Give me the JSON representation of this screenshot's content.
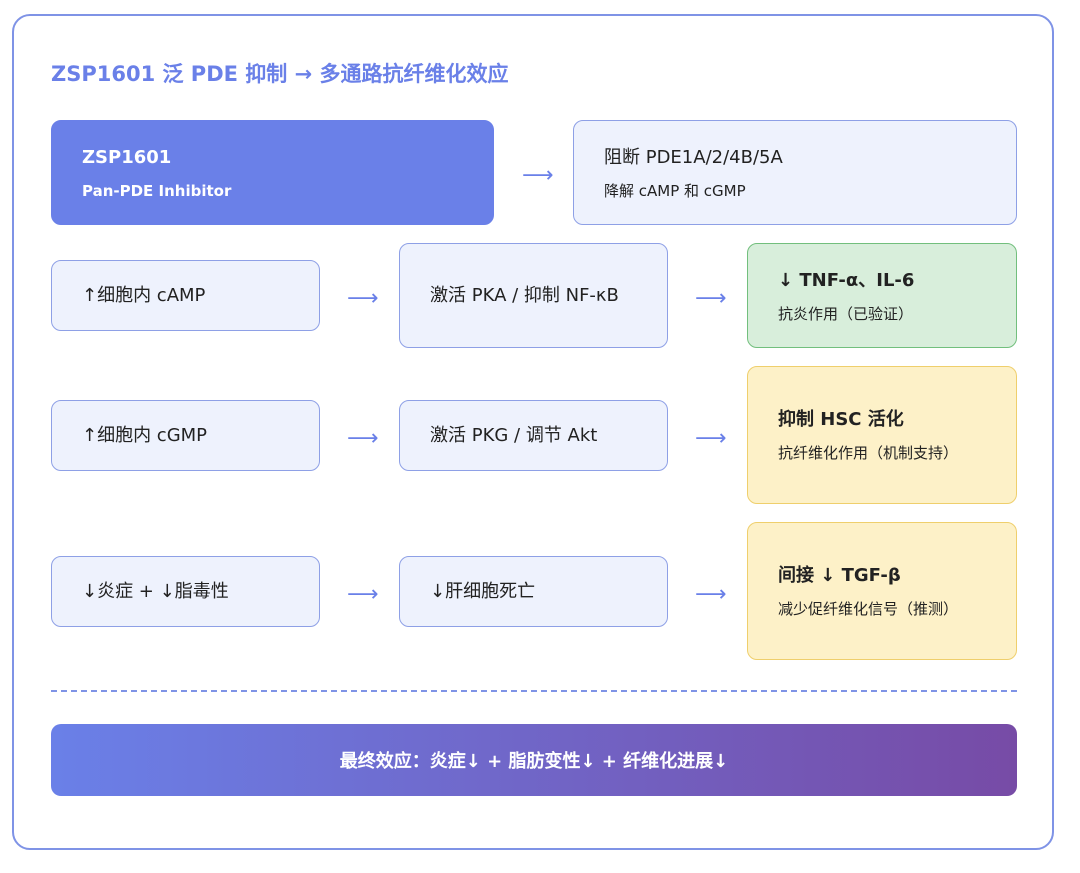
{
  "title": "ZSP1601 泛 PDE 抑制 → 多通路抗纤维化效应",
  "arrow_glyph": "⟶",
  "row1": {
    "drug_name": "ZSP1601",
    "drug_class": "Pan-PDE Inhibitor",
    "block_main": "阻断 PDE1A/2/4B/5A",
    "block_sub": "降解 cAMP 和 cGMP"
  },
  "row2": {
    "step1": "↑细胞内 cAMP",
    "step2": "激活 PKA / 抑制 NF-κB",
    "result_main": "↓ TNF-α、IL-6",
    "result_sub": "抗炎作用（已验证）"
  },
  "row3": {
    "step1": "↑细胞内 cGMP",
    "step2": "激活 PKG / 调节 Akt",
    "result_main": "抑制 HSC 活化",
    "result_sub": "抗纤维化作用（机制支持）"
  },
  "row4": {
    "step1": "↓炎症 + ↓脂毒性",
    "step2": "↓肝细胞死亡",
    "result_main": "间接 ↓ TGF-β",
    "result_sub": "减少促纤维化信号（推测）"
  },
  "final": "最终效应：炎症↓ + 脂肪变性↓ + 纤维化进展↓",
  "colors": {
    "accent": "#6a80e8",
    "node_bg": "#eef2fd",
    "validated_bg": "#d8eedb",
    "mechanism_bg": "#fdf1c8",
    "gradient_end": "#774ba6"
  }
}
